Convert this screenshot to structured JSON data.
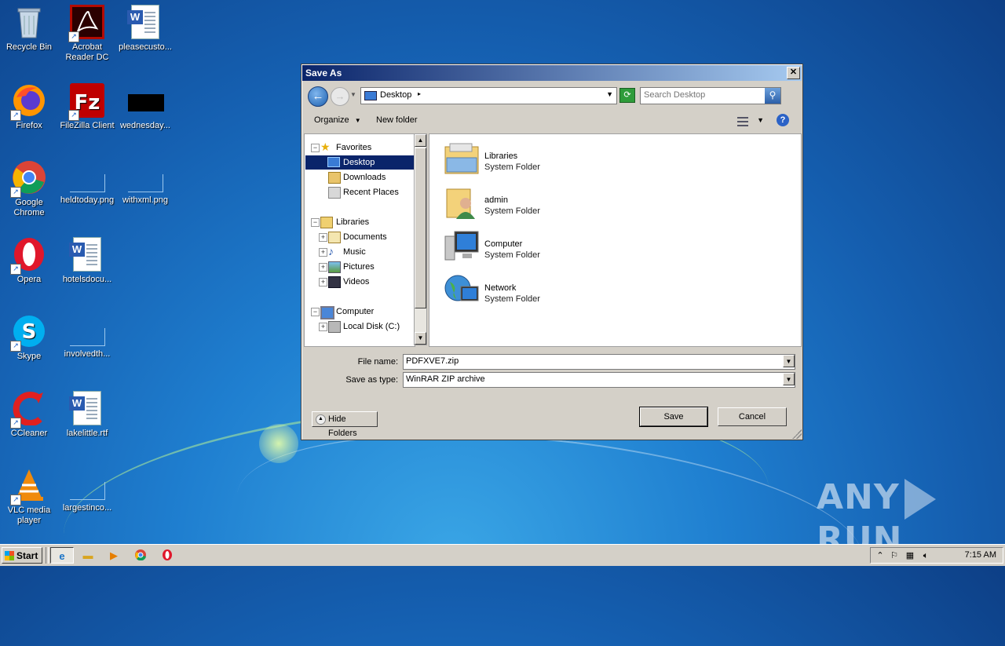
{
  "desktop": {
    "icons": [
      {
        "label": "Recycle Bin"
      },
      {
        "label": "Acrobat Reader DC"
      },
      {
        "label": "pleasecusto..."
      },
      {
        "label": "Firefox"
      },
      {
        "label": "FileZilla Client"
      },
      {
        "label": "wednesday..."
      },
      {
        "label": "Google Chrome"
      },
      {
        "label": "heldtoday.png"
      },
      {
        "label": "withxml.png"
      },
      {
        "label": "Opera"
      },
      {
        "label": "hotelsdocu..."
      },
      {
        "label": "Skype"
      },
      {
        "label": "involvedth..."
      },
      {
        "label": "CCleaner"
      },
      {
        "label": "lakelittle.rtf"
      },
      {
        "label": "VLC media player"
      },
      {
        "label": "largestinco..."
      }
    ],
    "watermark": "ANY RUN",
    "watermark_parts": {
      "left": "ANY",
      "right": "RUN"
    }
  },
  "dialog": {
    "title": "Save As",
    "close_label": "✕",
    "address": {
      "location": "Desktop"
    },
    "search": {
      "placeholder": "Search Desktop"
    },
    "toolbar": {
      "organize": "Organize",
      "new_folder": "New folder",
      "help": "?"
    },
    "nav_tree": [
      {
        "label": "Favorites",
        "icon": "star-icon"
      },
      {
        "label": "Desktop",
        "icon": "desktop-icon",
        "selected": true
      },
      {
        "label": "Downloads",
        "icon": "downloads-icon"
      },
      {
        "label": "Recent Places",
        "icon": "recent-places-icon"
      },
      {
        "label": "Libraries",
        "icon": "libraries-icon"
      },
      {
        "label": "Documents",
        "icon": "documents-icon"
      },
      {
        "label": "Music",
        "icon": "music-icon"
      },
      {
        "label": "Pictures",
        "icon": "pictures-icon"
      },
      {
        "label": "Videos",
        "icon": "videos-icon"
      },
      {
        "label": "Computer",
        "icon": "computer-icon"
      },
      {
        "label": "Local Disk (C:)",
        "icon": "disk-icon"
      }
    ],
    "items": [
      {
        "name": "Libraries",
        "type": "System Folder",
        "icon": "libraries-folder-icon"
      },
      {
        "name": "admin",
        "type": "System Folder",
        "icon": "user-folder-icon"
      },
      {
        "name": "Computer",
        "type": "System Folder",
        "icon": "computer-icon"
      },
      {
        "name": "Network",
        "type": "System Folder",
        "icon": "network-icon"
      }
    ],
    "file_name": {
      "label": "File name:",
      "value": "PDFXVE7.zip"
    },
    "save_type": {
      "label": "Save as type:",
      "value": "WinRAR ZIP archive"
    },
    "hide_folders": "Hide Folders",
    "save_button": "Save",
    "cancel_button": "Cancel"
  },
  "taskbar": {
    "start_label": "Start",
    "clock": "7:15 AM"
  },
  "colors": {
    "selection": "#0a246a",
    "title_gradient_start": "#0a246a",
    "title_gradient_end": "#a6caf0",
    "chrome": "#d4d0c8"
  }
}
